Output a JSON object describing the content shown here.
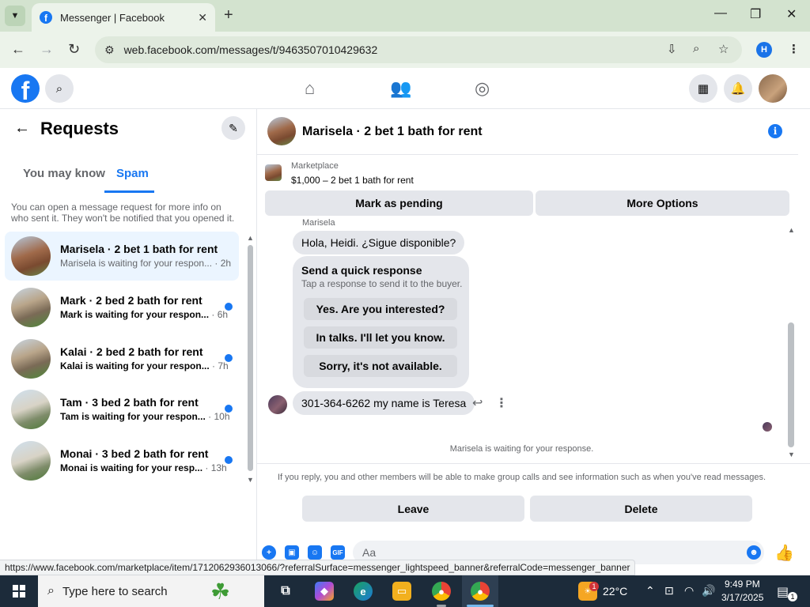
{
  "browser": {
    "tab_title": "Messenger | Facebook",
    "tab_close": "✕",
    "new_tab": "+",
    "url": "web.facebook.com/messages/t/9463507010429632",
    "profile_initial": "H",
    "status_url": "https://www.facebook.com/marketplace/item/1712062936013066/?referralSurface=messenger_lightspeed_banner&referralCode=messenger_banner"
  },
  "left": {
    "title": "Requests",
    "tabs": [
      "You may know",
      "Spam"
    ],
    "note": "You can open a message request for more info on who sent it. They won't be notified that you opened it.",
    "threads": [
      {
        "name": "Marisela · 2 bet 1 bath for rent",
        "snippet": "Marisela is waiting for your respon...",
        "time": "· 2h"
      },
      {
        "name": "Mark · 2 bed 2 bath for rent",
        "snippet": "Mark is waiting for your respon...",
        "time": "· 6h"
      },
      {
        "name": "Kalai · 2 bed 2 bath for rent",
        "snippet": "Kalai is waiting for your respon...",
        "time": "· 7h"
      },
      {
        "name": "Tam · 3 bed 2 bath for rent",
        "snippet": "Tam is waiting for your respon...",
        "time": "· 10h"
      },
      {
        "name": "Monai · 3 bed 2 bath for rent",
        "snippet": "Monai is waiting for your resp...",
        "time": "· 13h"
      }
    ]
  },
  "chat": {
    "title": "Marisela · 2 bet 1 bath for rent",
    "marketplace_label": "Marketplace",
    "listing": "$1,000 – 2 bet 1 bath for rent",
    "mark_pending": "Mark as pending",
    "more_options": "More Options",
    "sender_cut": "Marisela",
    "msg1": "Hola, Heidi. ¿Sigue disponible?",
    "quick_title": "Send a quick response",
    "quick_sub": "Tap a response to send it to the buyer.",
    "quick_options": [
      "Yes. Are you interested?",
      "In talks. I'll let you know.",
      "Sorry, it's not available."
    ],
    "msg2": "301-364-6262 my name is Teresa",
    "waiting": "Marisela is waiting for your response.",
    "bottom_note": "If you reply, you and other members will be able to make group calls and see information such as when you've read messages.",
    "leave": "Leave",
    "delete": "Delete",
    "composer_placeholder": "Aa"
  },
  "taskbar": {
    "search_placeholder": "Type here to search",
    "weather_temp": "22°C",
    "time": "9:49 PM",
    "date": "3/17/2025",
    "notif_count": "1",
    "weather_badge": "1"
  },
  "colors": {
    "fb_blue": "#1877f2",
    "chrome_tab": "#d3e3cf"
  }
}
